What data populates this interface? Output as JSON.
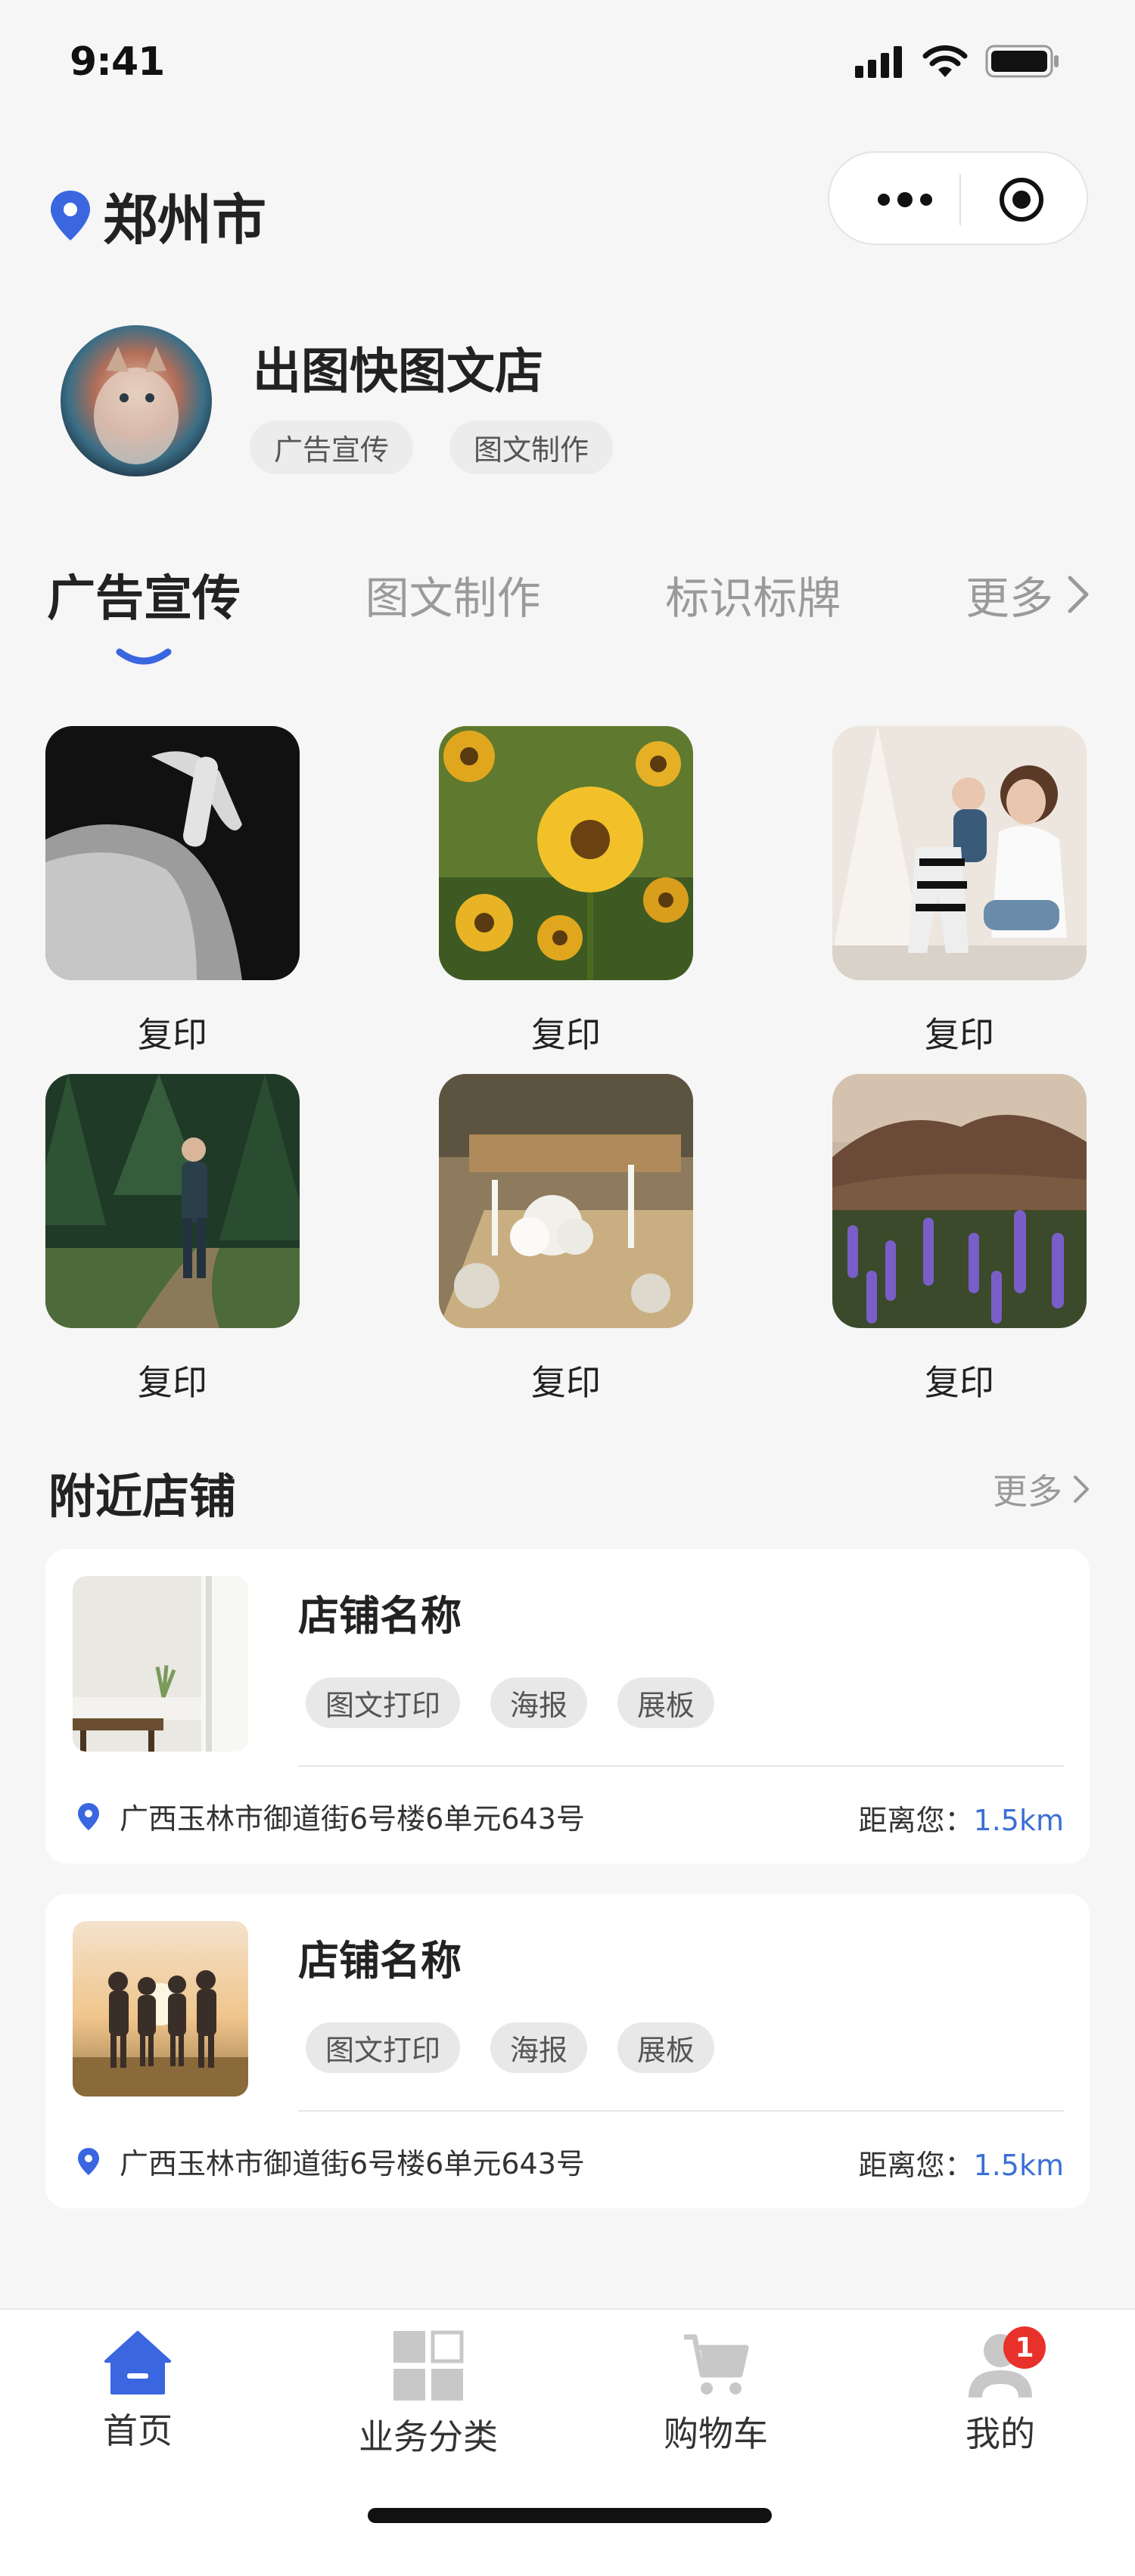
{
  "status": {
    "time": "9:41"
  },
  "header": {
    "city": "郑州市"
  },
  "store": {
    "name": "出图快图文店",
    "tags": [
      "广告宣传",
      "图文制作"
    ]
  },
  "tabs": [
    {
      "label": "广告宣传",
      "active": true
    },
    {
      "label": "图文制作",
      "active": false
    },
    {
      "label": "标识标牌",
      "active": false
    },
    {
      "label": "更多",
      "active": false
    }
  ],
  "grid": [
    {
      "label": "复印",
      "image": "photo-hand-knee"
    },
    {
      "label": "复印",
      "image": "photo-sunflowers"
    },
    {
      "label": "复印",
      "image": "photo-mother-child"
    },
    {
      "label": "复印",
      "image": "photo-forest-hiker"
    },
    {
      "label": "复印",
      "image": "photo-banquet-table"
    },
    {
      "label": "复印",
      "image": "photo-lupine-field"
    }
  ],
  "nearby": {
    "title": "附近店铺",
    "more": "更多",
    "stores": [
      {
        "name": "店铺名称",
        "tags": [
          "图文打印",
          "海报",
          "展板"
        ],
        "address": "广西玉林市御道街6号楼6单元643号",
        "distance_label": "距离您：",
        "distance_value": "1.5km",
        "image": "photo-room-interior"
      },
      {
        "name": "店铺名称",
        "tags": [
          "图文打印",
          "海报",
          "展板"
        ],
        "address": "广西玉林市御道街6号楼6单元643号",
        "distance_label": "距离您：",
        "distance_value": "1.5km",
        "image": "photo-friends-sunset"
      }
    ]
  },
  "tabbar": [
    {
      "label": "首页",
      "icon": "home-icon",
      "active": true
    },
    {
      "label": "业务分类",
      "icon": "category-grid-icon",
      "active": false
    },
    {
      "label": "购物车",
      "icon": "cart-icon",
      "active": false
    },
    {
      "label": "我的",
      "icon": "user-icon",
      "active": false,
      "badge": "1"
    }
  ],
  "colors": {
    "accent": "#3a66e0",
    "distance": "#3b6fd6",
    "badge": "#e8312a"
  }
}
